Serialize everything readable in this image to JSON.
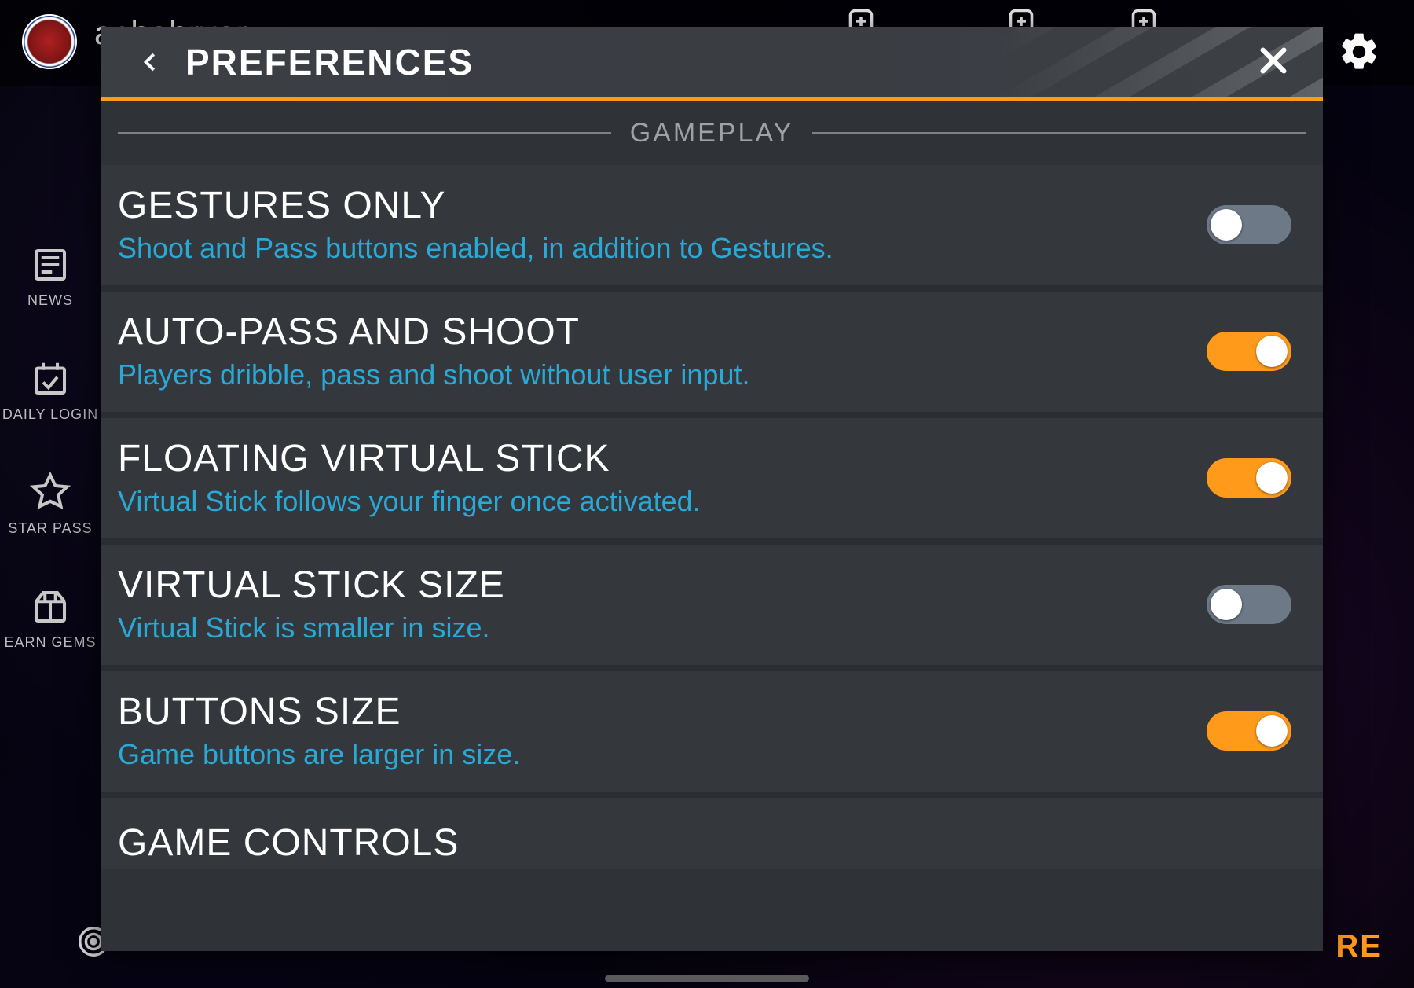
{
  "background": {
    "username_partial": "achahryar",
    "sidebar": [
      {
        "label": "NEWS",
        "icon": "news"
      },
      {
        "label": "DAILY LOGIN",
        "icon": "calendar-check"
      },
      {
        "label": "STAR PASS",
        "icon": "star-badge"
      },
      {
        "label": "EARN GEMS",
        "icon": "gift"
      }
    ],
    "footer_partial": "RE"
  },
  "modal": {
    "title": "PREFERENCES",
    "section": "GAMEPLAY",
    "colors": {
      "accent": "#ff9a1a",
      "link": "#2aa8d6",
      "toggle_off": "#6d7987"
    },
    "rows": [
      {
        "title": "GESTURES ONLY",
        "desc": "Shoot and Pass buttons enabled, in addition to Gestures.",
        "on": false
      },
      {
        "title": "AUTO-PASS AND SHOOT",
        "desc": "Players dribble, pass and shoot without user input.",
        "on": true
      },
      {
        "title": "FLOATING VIRTUAL STICK",
        "desc": "Virtual Stick follows your finger once activated.",
        "on": true
      },
      {
        "title": "VIRTUAL STICK SIZE",
        "desc": "Virtual Stick is smaller in size.",
        "on": false
      },
      {
        "title": "BUTTONS SIZE",
        "desc": "Game buttons are larger in size.",
        "on": true
      },
      {
        "title": "GAME CONTROLS",
        "desc": "",
        "on": false,
        "cut": true
      }
    ]
  }
}
